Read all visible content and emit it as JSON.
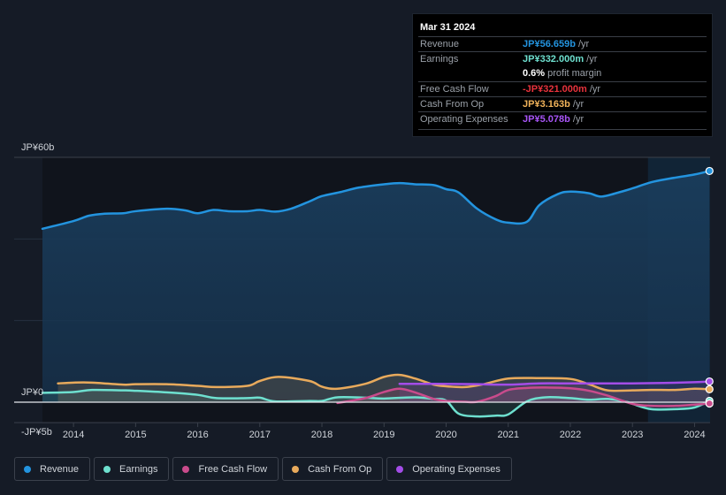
{
  "tooltip": {
    "date": "Mar 31 2024",
    "rows": [
      {
        "label": "Revenue",
        "value": "JP¥56.659b",
        "suffix": " /yr",
        "color": "#2394df"
      },
      {
        "label": "Earnings",
        "value": "JP¥332.000m",
        "suffix": " /yr",
        "color": "#6ee0cf"
      },
      {
        "label": "",
        "value": "0.6%",
        "suffix": " profit margin",
        "color": "#ffffff"
      },
      {
        "label": "Free Cash Flow",
        "value": "-JP¥321.000m",
        "suffix": " /yr",
        "color": "#e8323c"
      },
      {
        "label": "Cash From Op",
        "value": "JP¥3.163b",
        "suffix": " /yr",
        "color": "#f0b25a"
      },
      {
        "label": "Operating Expenses",
        "value": "JP¥5.078b",
        "suffix": " /yr",
        "color": "#a855f7"
      }
    ]
  },
  "legend": [
    {
      "label": "Revenue",
      "color": "#2394df"
    },
    {
      "label": "Earnings",
      "color": "#6ee0cf"
    },
    {
      "label": "Free Cash Flow",
      "color": "#c94b8c"
    },
    {
      "label": "Cash From Op",
      "color": "#e8aa5c"
    },
    {
      "label": "Operating Expenses",
      "color": "#a34de8"
    }
  ],
  "chart_data": {
    "type": "area",
    "title": "",
    "xlabel": "",
    "ylabel": "",
    "currency": "JPY",
    "y_unit": "billions",
    "ylim": [
      -5,
      60
    ],
    "xlim": [
      2013.5,
      2024.25
    ],
    "y_tick_labels": [
      {
        "value": 60,
        "label": "JP¥60b"
      },
      {
        "value": 0,
        "label": "JP¥0"
      },
      {
        "value": -5,
        "label": "-JP¥5b"
      }
    ],
    "x_ticks": [
      2014,
      2015,
      2016,
      2017,
      2018,
      2019,
      2020,
      2021,
      2022,
      2023,
      2024
    ],
    "x_tick_labels": [
      "2014",
      "2015",
      "2016",
      "2017",
      "2018",
      "2019",
      "2020",
      "2021",
      "2022",
      "2023",
      "2024"
    ],
    "highlight_start": 2023.25,
    "grid": true,
    "legend_position": "bottom",
    "series": [
      {
        "name": "Revenue",
        "color": "#2394df",
        "x": [
          2013.5,
          2014,
          2014.25,
          2014.5,
          2014.8,
          2015,
          2015.5,
          2015.8,
          2016,
          2016.25,
          2016.5,
          2016.8,
          2017,
          2017.25,
          2017.5,
          2017.8,
          2018,
          2018.3,
          2018.6,
          2019,
          2019.25,
          2019.5,
          2019.8,
          2020,
          2020.2,
          2020.5,
          2020.8,
          2021,
          2021.3,
          2021.5,
          2021.8,
          2022,
          2022.3,
          2022.5,
          2022.8,
          2023,
          2023.3,
          2023.6,
          2024,
          2024.24
        ],
        "values": [
          42.5,
          44.4,
          45.7,
          46.2,
          46.3,
          46.8,
          47.4,
          47.0,
          46.3,
          47.1,
          46.8,
          46.8,
          47.1,
          46.7,
          47.4,
          49.2,
          50.5,
          51.5,
          52.6,
          53.4,
          53.7,
          53.4,
          53.2,
          52.2,
          51.4,
          47.4,
          44.8,
          44.0,
          44.2,
          48.3,
          51.0,
          51.6,
          51.2,
          50.4,
          51.5,
          52.4,
          53.9,
          54.8,
          55.8,
          56.66
        ]
      },
      {
        "name": "Earnings",
        "color": "#6ee0cf",
        "x": [
          2013.5,
          2014,
          2014.3,
          2014.8,
          2015,
          2015.5,
          2016,
          2016.3,
          2016.8,
          2017,
          2017.25,
          2017.8,
          2018,
          2018.25,
          2018.7,
          2019,
          2019.5,
          2019.8,
          2020,
          2020.2,
          2020.5,
          2020.8,
          2021,
          2021.3,
          2021.6,
          2022,
          2022.3,
          2022.6,
          2022.9,
          2023,
          2023.3,
          2023.7,
          2024,
          2024.24
        ],
        "values": [
          2.3,
          2.5,
          3.0,
          2.9,
          2.8,
          2.4,
          1.8,
          1.0,
          1.0,
          1.1,
          0.2,
          0.3,
          0.3,
          1.2,
          1.1,
          0.9,
          1.2,
          0.8,
          0.4,
          -2.8,
          -3.5,
          -3.3,
          -3.0,
          0.2,
          1.2,
          1.0,
          0.6,
          0.8,
          0.1,
          -0.4,
          -1.7,
          -1.7,
          -1.3,
          0.33
        ]
      },
      {
        "name": "Free Cash Flow",
        "color": "#c94b8c",
        "x": [
          2018.25,
          2018.7,
          2019,
          2019.25,
          2019.5,
          2019.8,
          2020,
          2020.3,
          2020.5,
          2020.8,
          2021,
          2021.3,
          2021.6,
          2022,
          2022.3,
          2022.6,
          2023,
          2023.3,
          2023.7,
          2024,
          2024.24
        ],
        "values": [
          -0.2,
          1.0,
          2.5,
          3.3,
          2.4,
          0.8,
          0.3,
          0.1,
          0.1,
          1.5,
          3.0,
          3.5,
          3.6,
          3.4,
          2.8,
          1.6,
          -0.4,
          -0.9,
          -0.9,
          -0.6,
          -0.321
        ]
      },
      {
        "name": "Cash From Op",
        "color": "#e8aa5c",
        "x": [
          2013.75,
          2014,
          2014.3,
          2014.8,
          2015,
          2015.5,
          2016,
          2016.3,
          2016.8,
          2017,
          2017.3,
          2017.8,
          2018,
          2018.25,
          2018.7,
          2019,
          2019.25,
          2019.5,
          2019.8,
          2020,
          2020.3,
          2020.6,
          2021,
          2021.5,
          2022,
          2022.3,
          2022.6,
          2023,
          2023.3,
          2023.7,
          2024,
          2024.24
        ],
        "values": [
          4.6,
          4.8,
          4.8,
          4.3,
          4.4,
          4.4,
          4.0,
          3.7,
          4.0,
          5.2,
          6.2,
          5.2,
          3.8,
          3.3,
          4.5,
          6.2,
          6.7,
          5.8,
          4.3,
          3.9,
          3.7,
          4.4,
          5.8,
          5.9,
          5.7,
          4.4,
          2.9,
          2.9,
          3.0,
          3.0,
          3.3,
          3.16
        ]
      },
      {
        "name": "Operating Expenses",
        "color": "#a34de8",
        "x": [
          2019.25,
          2019.8,
          2020.5,
          2021,
          2021.5,
          2022,
          2022.5,
          2023,
          2023.5,
          2024,
          2024.24
        ],
        "values": [
          4.5,
          4.5,
          4.4,
          4.3,
          4.6,
          4.6,
          4.6,
          4.6,
          4.7,
          4.9,
          5.08
        ]
      }
    ]
  }
}
